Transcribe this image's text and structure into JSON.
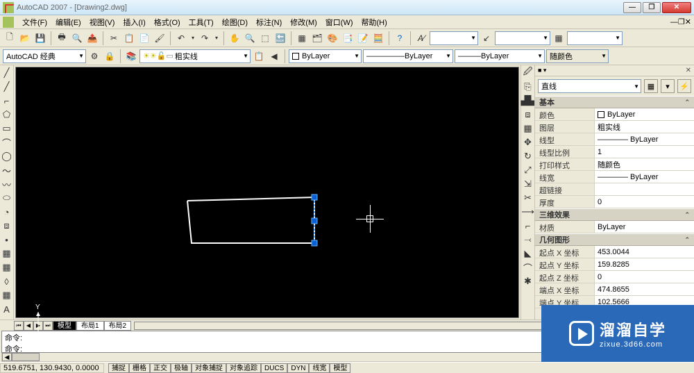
{
  "title": "AutoCAD 2007 - [Drawing2.dwg]",
  "menus": [
    "文件(F)",
    "编辑(E)",
    "视图(V)",
    "插入(I)",
    "格式(O)",
    "工具(T)",
    "绘图(D)",
    "标注(N)",
    "修改(M)",
    "窗口(W)",
    "帮助(H)"
  ],
  "toolbar1_icons": [
    "📄",
    "📂",
    "💾",
    "🖨",
    "✂",
    "📋",
    "📋",
    "↶",
    "↷",
    "🔍",
    "🔎",
    "🌐",
    "⬜",
    "🎨",
    "📐",
    "🧮",
    "❓"
  ],
  "workspace_dd": "AutoCAD 经典",
  "layer_dd": "粗实线",
  "dd_bylayer": "ByLayer",
  "dd_byblock": "ByLayer",
  "dd_linetype": "ByLayer",
  "dd_color": "随颜色",
  "left_tools": [
    "╱",
    "╱",
    "⌒",
    "⬭",
    "〰",
    "⬠",
    "▭",
    "◯",
    "〜",
    "◔",
    "⬯",
    "⬯",
    "•",
    "▦",
    "▦",
    "A"
  ],
  "right_tools": [
    "🖉",
    "✎",
    "🗑",
    "⎘",
    "⧉",
    "▦",
    "+",
    "↻",
    "⇅",
    "⤢",
    "✂",
    "⧈",
    "⌐",
    "◐",
    "⌒",
    "╱",
    "✱"
  ],
  "props": {
    "selector": "直线",
    "cat_basic": "基本",
    "basic": [
      {
        "k": "颜色",
        "v": "ByLayer",
        "swatch": true
      },
      {
        "k": "图层",
        "v": "粗实线"
      },
      {
        "k": "线型",
        "v": "———— ByLayer"
      },
      {
        "k": "线型比例",
        "v": "1"
      },
      {
        "k": "打印样式",
        "v": "随颜色"
      },
      {
        "k": "线宽",
        "v": "———— ByLayer"
      },
      {
        "k": "超链接",
        "v": ""
      },
      {
        "k": "厚度",
        "v": "0"
      }
    ],
    "cat_3d": "三维效果",
    "threed": [
      {
        "k": "材质",
        "v": "ByLayer"
      }
    ],
    "cat_geom": "几何图形",
    "geom": [
      {
        "k": "起点 X 坐标",
        "v": "453.0044"
      },
      {
        "k": "起点 Y 坐标",
        "v": "159.8285"
      },
      {
        "k": "起点 Z 坐标",
        "v": "0"
      },
      {
        "k": "端点 X 坐标",
        "v": "474.8655"
      },
      {
        "k": "端点 Y 坐标",
        "v": "102.5666"
      }
    ]
  },
  "tabs": {
    "model": "模型",
    "layout1": "布局1",
    "layout2": "布局2"
  },
  "cmd_prompt": "命令:",
  "status": {
    "coords": "519.6751, 130.9430, 0.0000",
    "buttons": [
      "捕捉",
      "栅格",
      "正交",
      "极轴",
      "对象捕捉",
      "对象追踪",
      "DUCS",
      "DYN",
      "线宽",
      "模型"
    ]
  },
  "watermark": {
    "big": "溜溜自学",
    "small": "zixue.3d66.com"
  }
}
